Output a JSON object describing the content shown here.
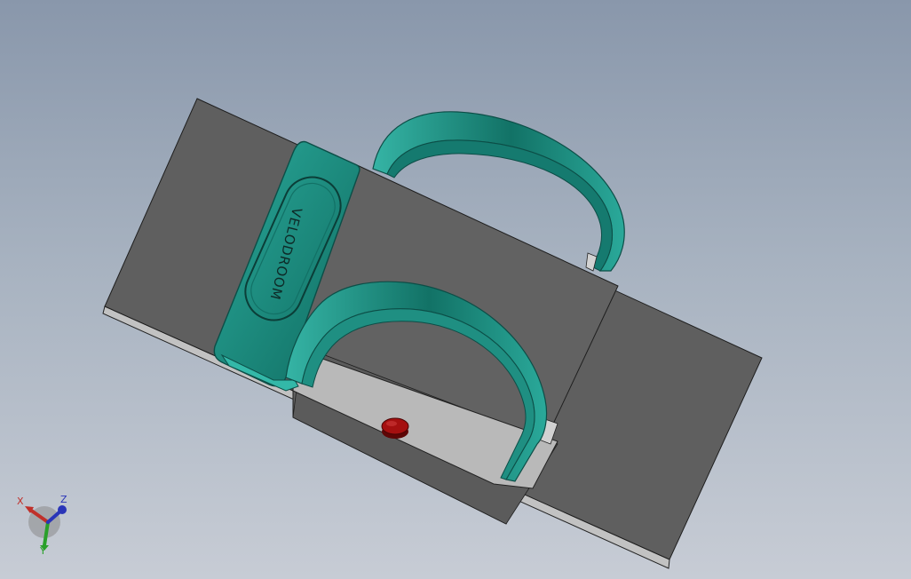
{
  "viewport": {
    "background_top": "#8997ab",
    "background_bottom": "#c7ccd5"
  },
  "model": {
    "base_plate_color": "#5f5f5f",
    "base_edge_color": "#c0c0c0",
    "center_block_color": "#606060",
    "front_face_color": "#b9b9b9",
    "clip_color": "#2aa99a",
    "clip_shadow_color": "#0d5e55",
    "strap_color": "#1d8a7d",
    "screw_color": "#a51010",
    "embossed_text": "VELODROOM"
  },
  "triad": {
    "x_label": "X",
    "y_label": "Y",
    "z_label": "Z",
    "x_color": "#c0302a",
    "y_color": "#2aa02a",
    "z_color": "#2a35b8"
  }
}
